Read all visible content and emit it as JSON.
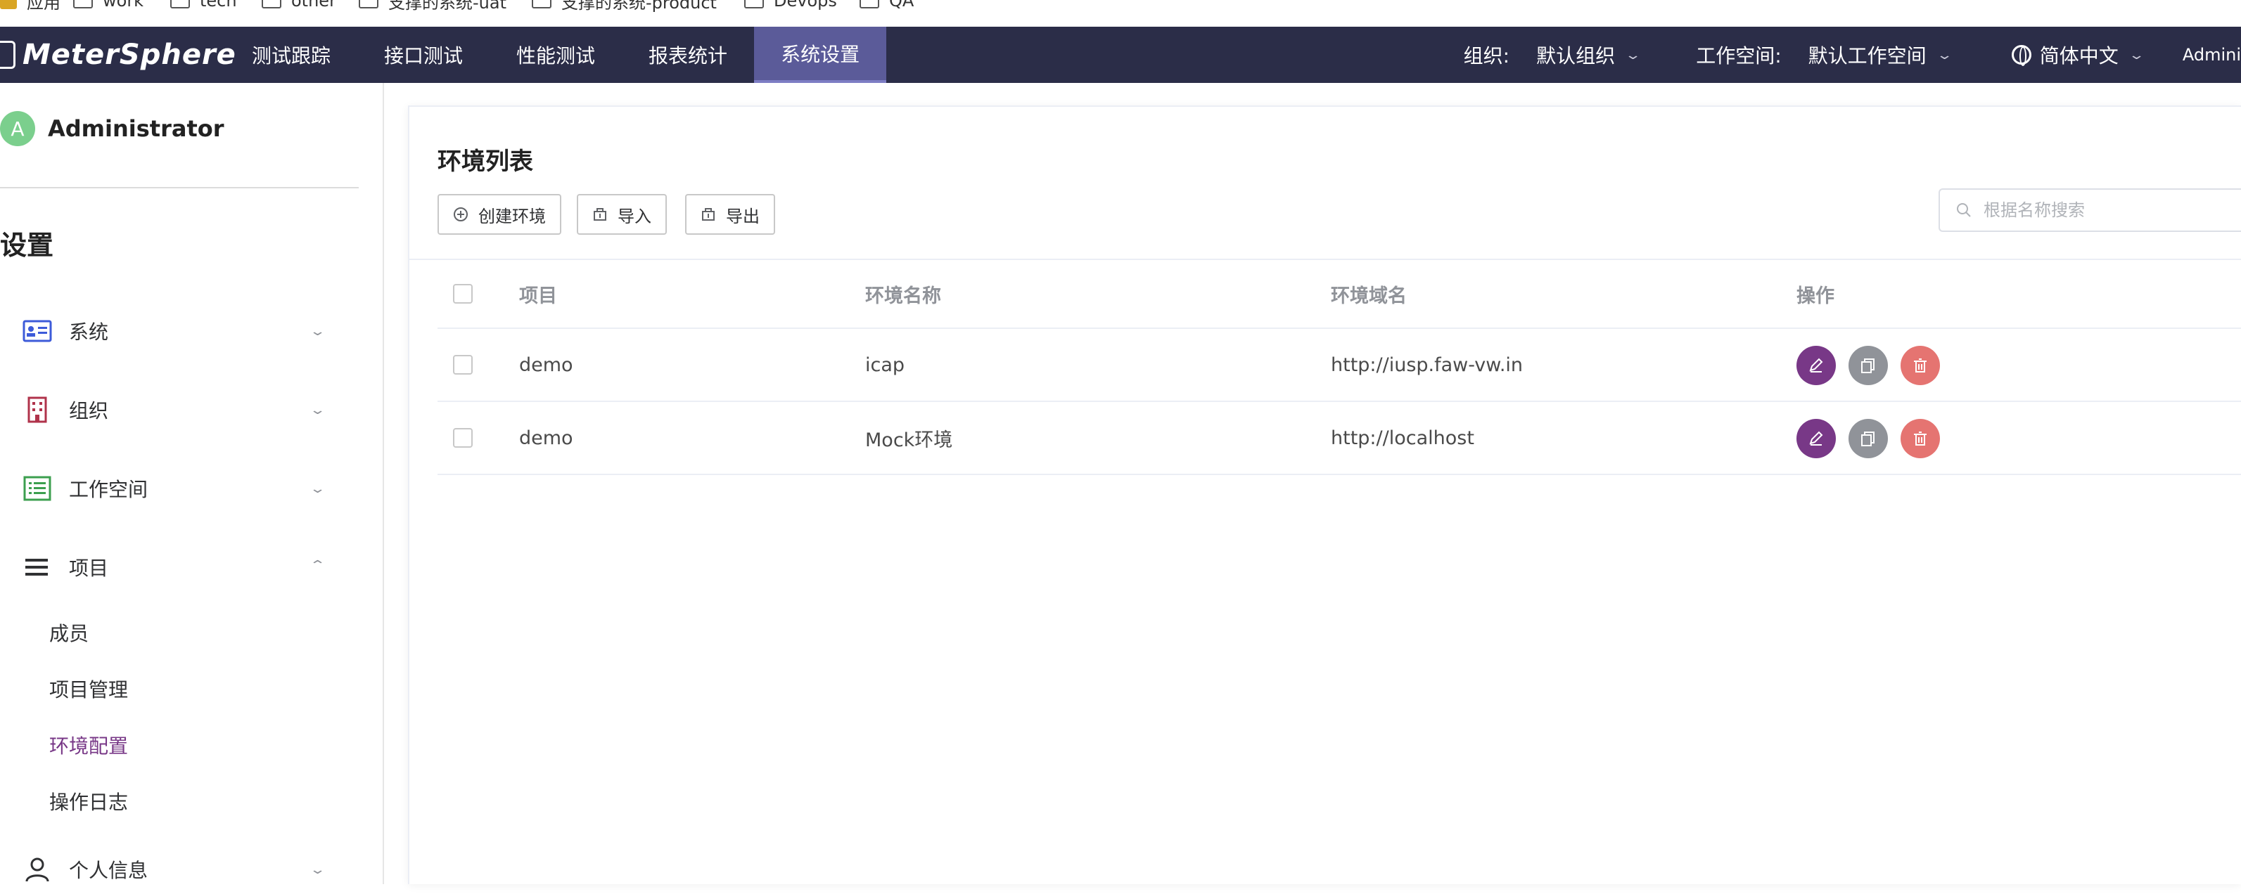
{
  "bookmarks": [
    {
      "label": "应用",
      "icon": "apps-icon"
    },
    {
      "label": "work",
      "icon": "folder-icon"
    },
    {
      "label": "tech",
      "icon": "folder-icon"
    },
    {
      "label": "other",
      "icon": "folder-icon"
    },
    {
      "label": "支撑的系统-uat",
      "icon": "folder-icon"
    },
    {
      "label": "支撑的系统-product",
      "icon": "folder-icon"
    },
    {
      "label": "Devops",
      "icon": "folder-icon"
    },
    {
      "label": "QA",
      "icon": "folder-icon"
    }
  ],
  "header": {
    "logo": "MeterSphere",
    "nav": [
      "测试跟踪",
      "接口测试",
      "性能测试",
      "报表统计",
      "系统设置"
    ],
    "active_nav": "系统设置",
    "org_label": "组织:",
    "org_value": "默认组织",
    "workspace_label": "工作空间:",
    "workspace_value": "默认工作空间",
    "language": "简体中文",
    "user_short": "Admini"
  },
  "sidebar": {
    "avatar_letter": "A",
    "username": "Administrator",
    "title": "设置",
    "menus": [
      {
        "label": "系统",
        "icon": "id-card-icon",
        "expanded": false
      },
      {
        "label": "组织",
        "icon": "building-icon",
        "expanded": false
      },
      {
        "label": "工作空间",
        "icon": "list-icon",
        "expanded": false
      },
      {
        "label": "项目",
        "icon": "menu-icon",
        "expanded": true
      },
      {
        "label": "个人信息",
        "icon": "user-icon",
        "expanded": false
      }
    ],
    "project_items": [
      "成员",
      "项目管理",
      "环境配置",
      "操作日志"
    ],
    "active_item": "环境配置"
  },
  "content": {
    "title": "环境列表",
    "buttons": {
      "create": "创建环境",
      "import": "导入",
      "export": "导出"
    },
    "search_placeholder": "根据名称搜索",
    "columns": [
      "项目",
      "环境名称",
      "环境域名",
      "操作"
    ],
    "rows": [
      {
        "project": "demo",
        "name": "icap",
        "domain": "http://iusp.faw-vw.in"
      },
      {
        "project": "demo",
        "name": "Mock环境",
        "domain": "http://localhost"
      }
    ],
    "colors": {
      "edit": "#783887",
      "copy": "#909399",
      "delete": "#e57471",
      "accent": "#783887",
      "nav_bg": "#2b2d48",
      "nav_active": "#5b5b99"
    }
  }
}
